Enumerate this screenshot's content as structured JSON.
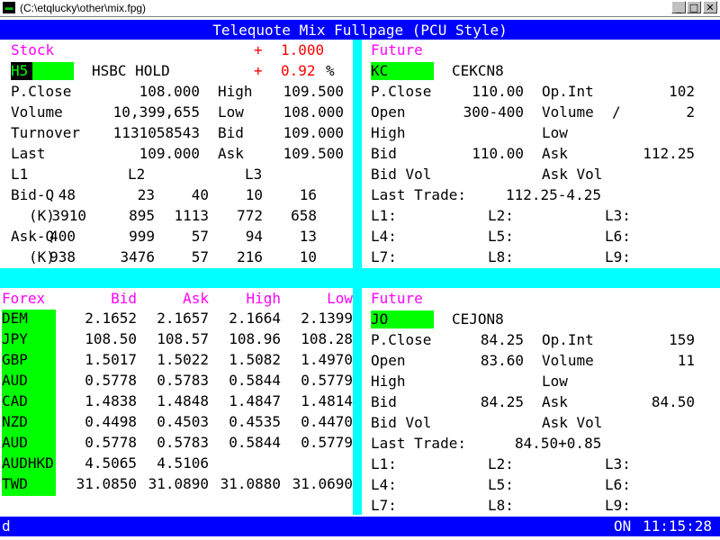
{
  "window": {
    "title": "(C:\\etqlucky\\other\\mix.fpg)"
  },
  "header": {
    "title": "Telequote Mix Fullpage (PCU Style)"
  },
  "stock": {
    "section_label": "Stock",
    "change_sign": "+",
    "change": "1.000",
    "pct_sign": "+",
    "pct": "0.92",
    "pct_unit": "%",
    "code": "H5",
    "name": "HSBC HOLD",
    "rows": [
      {
        "l1": "P.Close",
        "v1": "108.000",
        "l2": "High",
        "v2": "109.500"
      },
      {
        "l1": "Volume",
        "v1": "10,399,655",
        "l2": "Low",
        "v2": "108.000"
      },
      {
        "l1": "Turnover",
        "v1": "1131058543",
        "l2": "Bid",
        "v2": "109.000"
      },
      {
        "l1": "Last",
        "v1": "109.000",
        "l2": "Ask",
        "v2": "109.500"
      }
    ],
    "levels": [
      "L1",
      "L2",
      "L3"
    ],
    "bid_q": {
      "label": "Bid-Q",
      "values": [
        "48",
        "23",
        "40",
        "10",
        "16"
      ]
    },
    "bid_k": {
      "label": "(K)",
      "values": [
        "3910",
        "895",
        "1113",
        "772",
        "658"
      ]
    },
    "ask_q": {
      "label": "Ask-Q",
      "values": [
        "400",
        "999",
        "57",
        "94",
        "13"
      ]
    },
    "ask_k": {
      "label": "(K)",
      "values": [
        "938",
        "3476",
        "57",
        "216",
        "10"
      ]
    }
  },
  "future1": {
    "section_label": "Future",
    "code": "KC",
    "name": "CEKCN8",
    "pclose_label": "P.Close",
    "pclose": "110.00",
    "opint_label": "Op.Int",
    "opint": "102",
    "open_label": "Open",
    "open": "300-400",
    "volume_label": "Volume",
    "volume_sep": "/",
    "volume": "2",
    "high_label": "High",
    "high": "",
    "low_label": "Low",
    "low": "",
    "bid_label": "Bid",
    "bid": "110.00",
    "ask_label": "Ask",
    "ask": "112.25",
    "bidvol_label": "Bid Vol",
    "askvol_label": "Ask Vol",
    "last_trade_label": "Last Trade:",
    "last_trade": "112.25-4.25",
    "levels": [
      "L1:",
      "L2:",
      "L3:",
      "L4:",
      "L5:",
      "L6:",
      "L7:",
      "L8:",
      "L9:"
    ]
  },
  "forex": {
    "headers": {
      "name": "Forex",
      "bid": "Bid",
      "ask": "Ask",
      "high": "High",
      "low": "Low"
    },
    "rows": [
      {
        "name": "DEM",
        "bid": "2.1652",
        "ask": "2.1657",
        "high": "2.1664",
        "low": "2.1399"
      },
      {
        "name": "JPY",
        "bid": "108.50",
        "ask": "108.57",
        "high": "108.96",
        "low": "108.28"
      },
      {
        "name": "GBP",
        "bid": "1.5017",
        "ask": "1.5022",
        "high": "1.5082",
        "low": "1.4970"
      },
      {
        "name": "AUD",
        "bid": "0.5778",
        "ask": "0.5783",
        "high": "0.5844",
        "low": "0.5779"
      },
      {
        "name": "CAD",
        "bid": "1.4838",
        "ask": "1.4848",
        "high": "1.4847",
        "low": "1.4814"
      },
      {
        "name": "NZD",
        "bid": "0.4498",
        "ask": "0.4503",
        "high": "0.4535",
        "low": "0.4470"
      },
      {
        "name": "AUD",
        "bid": "0.5778",
        "ask": "0.5783",
        "high": "0.5844",
        "low": "0.5779"
      },
      {
        "name": "AUDHKD",
        "bid": "4.5065",
        "ask": "4.5106",
        "high": "",
        "low": ""
      },
      {
        "name": "TWD",
        "bid": "31.0850",
        "ask": "31.0890",
        "high": "31.0880",
        "low": "31.0690"
      }
    ]
  },
  "future2": {
    "section_label": "Future",
    "code": "JO",
    "name": "CEJON8",
    "pclose_label": "P.Close",
    "pclose": "84.25",
    "opint_label": "Op.Int",
    "opint": "159",
    "open_label": "Open",
    "open": "83.60",
    "volume_label": "Volume",
    "volume": "11",
    "high_label": "High",
    "high": "",
    "low_label": "Low",
    "low": "",
    "bid_label": "Bid",
    "bid": "84.25",
    "ask_label": "Ask",
    "ask": "84.50",
    "bidvol_label": "Bid Vol",
    "askvol_label": "Ask Vol",
    "last_trade_label": "Last Trade:",
    "last_trade": "84.50+0.85",
    "levels": [
      "L1:",
      "L2:",
      "L3:",
      "L4:",
      "L5:",
      "L6:",
      "L7:",
      "L8:",
      "L9:"
    ]
  },
  "status": {
    "input": "d",
    "mode": "ON",
    "time": "11:15:28"
  }
}
